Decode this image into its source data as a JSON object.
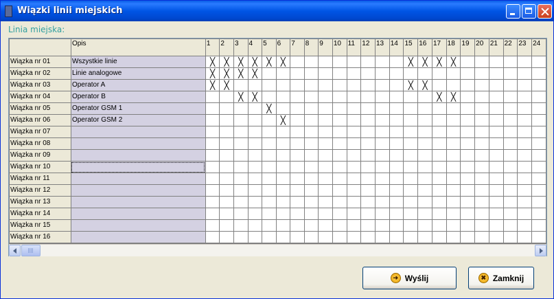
{
  "window": {
    "title": "Wiązki linii miejskich"
  },
  "group_label": "Linia miejska:",
  "grid": {
    "opis_header": "Opis",
    "columns": [
      "1",
      "2",
      "3",
      "4",
      "5",
      "6",
      "7",
      "8",
      "9",
      "10",
      "11",
      "12",
      "13",
      "14",
      "15",
      "16",
      "17",
      "18",
      "19",
      "20",
      "21",
      "22",
      "23",
      "24"
    ],
    "rows": [
      {
        "label": "Wiązka nr 01",
        "opis": "Wszystkie linie",
        "marks": [
          1,
          2,
          3,
          4,
          5,
          6,
          15,
          16,
          17,
          18
        ]
      },
      {
        "label": "Wiązka nr 02",
        "opis": "Linie analogowe",
        "marks": [
          1,
          2,
          3,
          4
        ]
      },
      {
        "label": "Wiązka nr 03",
        "opis": "Operator A",
        "marks": [
          1,
          2,
          15,
          16
        ]
      },
      {
        "label": "Wiązka nr 04",
        "opis": "Operator B",
        "marks": [
          3,
          4,
          17,
          18
        ]
      },
      {
        "label": "Wiązka nr 05",
        "opis": "Operator GSM 1",
        "marks": [
          5
        ]
      },
      {
        "label": "Wiązka nr 06",
        "opis": "Operator GSM 2",
        "marks": [
          6
        ]
      },
      {
        "label": "Wiązka nr 07",
        "opis": "",
        "marks": []
      },
      {
        "label": "Wiązka nr 08",
        "opis": "",
        "marks": []
      },
      {
        "label": "Wiązka nr 09",
        "opis": "",
        "marks": []
      },
      {
        "label": "Wiązka nr 10",
        "opis": "",
        "marks": [],
        "selected": true
      },
      {
        "label": "Wiązka nr 11",
        "opis": "",
        "marks": []
      },
      {
        "label": "Wiązka nr 12",
        "opis": "",
        "marks": []
      },
      {
        "label": "Wiązka nr 13",
        "opis": "",
        "marks": []
      },
      {
        "label": "Wiązka nr 14",
        "opis": "",
        "marks": []
      },
      {
        "label": "Wiązka nr 15",
        "opis": "",
        "marks": []
      },
      {
        "label": "Wiązka nr 16",
        "opis": "",
        "marks": []
      }
    ],
    "mark_symbol": "╳"
  },
  "buttons": {
    "send": "Wyślij",
    "close": "Zamknij"
  },
  "icons": {
    "send": "arrow-right-icon",
    "close": "x-circle-icon"
  }
}
